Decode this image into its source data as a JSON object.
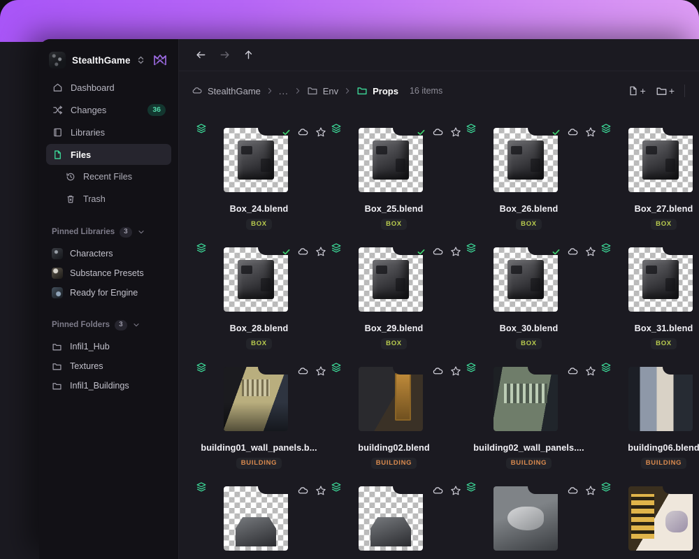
{
  "window": {
    "accent": "#3ddc9a",
    "backdrop_gradient_from": "#a855f7",
    "backdrop_gradient_to": "#e3a6f4"
  },
  "sidebar": {
    "workspace": {
      "name": "StealthGame",
      "switcher_icon": "chevron-updown-icon",
      "avatar_icon": "workspace-avatar",
      "brand_logo_icon": "anchorpoint-logo-icon"
    },
    "nav": [
      {
        "label": "Dashboard",
        "icon": "home-icon",
        "active": false,
        "badge": ""
      },
      {
        "label": "Changes",
        "icon": "shuffle-icon",
        "active": false,
        "badge": "36"
      },
      {
        "label": "Libraries",
        "icon": "book-icon",
        "active": false,
        "badge": ""
      },
      {
        "label": "Files",
        "icon": "file-icon",
        "active": true,
        "badge": ""
      }
    ],
    "sub_nav": [
      {
        "label": "Recent Files",
        "icon": "history-icon"
      },
      {
        "label": "Trash",
        "icon": "trash-icon"
      }
    ],
    "pinned_libraries": {
      "title": "Pinned Libraries",
      "count": "3",
      "chevron_icon": "chevron-down-icon",
      "items": [
        {
          "label": "Characters",
          "icon": "library-thumb-characters"
        },
        {
          "label": "Substance Presets",
          "icon": "library-thumb-substance"
        },
        {
          "label": "Ready for Engine",
          "icon": "library-thumb-engine"
        }
      ]
    },
    "pinned_folders": {
      "title": "Pinned Folders",
      "count": "3",
      "chevron_icon": "chevron-down-icon",
      "items": [
        {
          "label": "Infil1_Hub",
          "icon": "folder-icon"
        },
        {
          "label": "Textures",
          "icon": "folder-icon"
        },
        {
          "label": "Infil1_Buildings",
          "icon": "folder-icon"
        }
      ]
    }
  },
  "navbar": {
    "back_icon": "arrow-left-icon",
    "forward_icon": "arrow-right-icon",
    "up_icon": "arrow-up-icon"
  },
  "breadcrumb": {
    "items": [
      {
        "label": "StealthGame",
        "icon": "cloud-icon",
        "current": false
      },
      {
        "label": "...",
        "icon": "",
        "current": false
      },
      {
        "label": "Env",
        "icon": "folder-icon",
        "current": false
      },
      {
        "label": "Props",
        "icon": "folder-open-icon",
        "current": true
      }
    ],
    "separator": "chevron-right-icon",
    "item_count": "16 items",
    "actions": [
      {
        "name": "new-file-button",
        "icon": "file-plus-icon",
        "label": "+"
      },
      {
        "name": "new-folder-button",
        "icon": "folder-plus-icon",
        "label": "+"
      }
    ]
  },
  "grid": {
    "files": [
      {
        "name": "Box_24.blend",
        "tag": "BOX",
        "tag_style": "box",
        "thumb": "checker-box",
        "synced": true,
        "starred": false,
        "clipped": false
      },
      {
        "name": "Box_25.blend",
        "tag": "BOX",
        "tag_style": "box",
        "thumb": "checker-box",
        "synced": true,
        "starred": false,
        "clipped": false
      },
      {
        "name": "Box_26.blend",
        "tag": "BOX",
        "tag_style": "box",
        "thumb": "checker-box",
        "synced": true,
        "starred": false,
        "clipped": false
      },
      {
        "name": "Box_27.blend",
        "tag": "BOX",
        "tag_style": "box",
        "thumb": "checker-box",
        "synced": true,
        "starred": false,
        "clipped": true
      },
      {
        "name": "Box_28.blend",
        "tag": "BOX",
        "tag_style": "box",
        "thumb": "checker-box",
        "synced": true,
        "starred": false,
        "clipped": false
      },
      {
        "name": "Box_29.blend",
        "tag": "BOX",
        "tag_style": "box",
        "thumb": "checker-box",
        "synced": true,
        "starred": false,
        "clipped": false
      },
      {
        "name": "Box_30.blend",
        "tag": "BOX",
        "tag_style": "box",
        "thumb": "checker-box",
        "synced": true,
        "starred": false,
        "clipped": false
      },
      {
        "name": "Box_31.blend",
        "tag": "BOX",
        "tag_style": "box",
        "thumb": "checker-box",
        "synced": true,
        "starred": false,
        "clipped": true
      },
      {
        "name": "building01_wall_panels.b...",
        "tag": "BUILDING",
        "tag_style": "building",
        "thumb": "photo-b1",
        "synced": false,
        "starred": false,
        "clipped": false
      },
      {
        "name": "building02.blend",
        "tag": "BUILDING",
        "tag_style": "building",
        "thumb": "photo-b2",
        "synced": false,
        "starred": false,
        "clipped": false
      },
      {
        "name": "building02_wall_panels....",
        "tag": "BUILDING",
        "tag_style": "building",
        "thumb": "photo-b3",
        "synced": false,
        "starred": false,
        "clipped": false
      },
      {
        "name": "building06.blend",
        "tag": "BUILDING",
        "tag_style": "building",
        "thumb": "photo-b4",
        "synced": false,
        "starred": false,
        "clipped": true
      },
      {
        "name": "",
        "tag": "",
        "tag_style": "box",
        "thumb": "checker-mini",
        "synced": false,
        "starred": false,
        "clipped": false
      },
      {
        "name": "",
        "tag": "",
        "tag_style": "box",
        "thumb": "checker-mini",
        "synced": false,
        "starred": false,
        "clipped": false
      },
      {
        "name": "",
        "tag": "",
        "tag_style": "box",
        "thumb": "photo-m1",
        "synced": false,
        "starred": false,
        "clipped": false
      },
      {
        "name": "",
        "tag": "",
        "tag_style": "box",
        "thumb": "photo-m2",
        "synced": false,
        "starred": false,
        "clipped": true
      }
    ]
  }
}
